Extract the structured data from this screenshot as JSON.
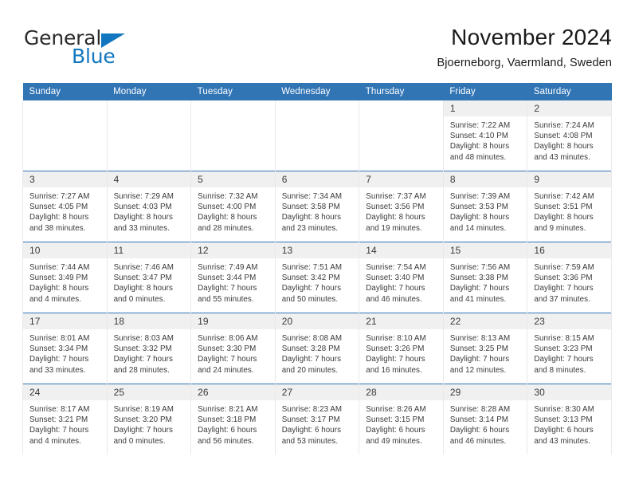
{
  "brand": {
    "name_top": "General",
    "name_bottom": "Blue",
    "triangle_icon": "triangle-icon",
    "accent_color": "#1277bf"
  },
  "header": {
    "title": "November 2024",
    "location": "Bjoerneborg, Vaermland, Sweden"
  },
  "theme": {
    "header_blue": "#3275b5",
    "daynum_band": "#f0f0f0",
    "text": "#3a3a3a"
  },
  "calendar": {
    "weekday_headers": [
      "Sunday",
      "Monday",
      "Tuesday",
      "Wednesday",
      "Thursday",
      "Friday",
      "Saturday"
    ],
    "weeks": [
      [
        {
          "day": "",
          "info": "",
          "empty": true
        },
        {
          "day": "",
          "info": "",
          "empty": true
        },
        {
          "day": "",
          "info": "",
          "empty": true
        },
        {
          "day": "",
          "info": "",
          "empty": true
        },
        {
          "day": "",
          "info": "",
          "empty": true
        },
        {
          "day": "1",
          "info": "Sunrise: 7:22 AM\nSunset: 4:10 PM\nDaylight: 8 hours\nand 48 minutes.",
          "empty": false
        },
        {
          "day": "2",
          "info": "Sunrise: 7:24 AM\nSunset: 4:08 PM\nDaylight: 8 hours\nand 43 minutes.",
          "empty": false
        }
      ],
      [
        {
          "day": "3",
          "info": "Sunrise: 7:27 AM\nSunset: 4:05 PM\nDaylight: 8 hours\nand 38 minutes.",
          "empty": false
        },
        {
          "day": "4",
          "info": "Sunrise: 7:29 AM\nSunset: 4:03 PM\nDaylight: 8 hours\nand 33 minutes.",
          "empty": false
        },
        {
          "day": "5",
          "info": "Sunrise: 7:32 AM\nSunset: 4:00 PM\nDaylight: 8 hours\nand 28 minutes.",
          "empty": false
        },
        {
          "day": "6",
          "info": "Sunrise: 7:34 AM\nSunset: 3:58 PM\nDaylight: 8 hours\nand 23 minutes.",
          "empty": false
        },
        {
          "day": "7",
          "info": "Sunrise: 7:37 AM\nSunset: 3:56 PM\nDaylight: 8 hours\nand 19 minutes.",
          "empty": false
        },
        {
          "day": "8",
          "info": "Sunrise: 7:39 AM\nSunset: 3:53 PM\nDaylight: 8 hours\nand 14 minutes.",
          "empty": false
        },
        {
          "day": "9",
          "info": "Sunrise: 7:42 AM\nSunset: 3:51 PM\nDaylight: 8 hours\nand 9 minutes.",
          "empty": false
        }
      ],
      [
        {
          "day": "10",
          "info": "Sunrise: 7:44 AM\nSunset: 3:49 PM\nDaylight: 8 hours\nand 4 minutes.",
          "empty": false
        },
        {
          "day": "11",
          "info": "Sunrise: 7:46 AM\nSunset: 3:47 PM\nDaylight: 8 hours\nand 0 minutes.",
          "empty": false
        },
        {
          "day": "12",
          "info": "Sunrise: 7:49 AM\nSunset: 3:44 PM\nDaylight: 7 hours\nand 55 minutes.",
          "empty": false
        },
        {
          "day": "13",
          "info": "Sunrise: 7:51 AM\nSunset: 3:42 PM\nDaylight: 7 hours\nand 50 minutes.",
          "empty": false
        },
        {
          "day": "14",
          "info": "Sunrise: 7:54 AM\nSunset: 3:40 PM\nDaylight: 7 hours\nand 46 minutes.",
          "empty": false
        },
        {
          "day": "15",
          "info": "Sunrise: 7:56 AM\nSunset: 3:38 PM\nDaylight: 7 hours\nand 41 minutes.",
          "empty": false
        },
        {
          "day": "16",
          "info": "Sunrise: 7:59 AM\nSunset: 3:36 PM\nDaylight: 7 hours\nand 37 minutes.",
          "empty": false
        }
      ],
      [
        {
          "day": "17",
          "info": "Sunrise: 8:01 AM\nSunset: 3:34 PM\nDaylight: 7 hours\nand 33 minutes.",
          "empty": false
        },
        {
          "day": "18",
          "info": "Sunrise: 8:03 AM\nSunset: 3:32 PM\nDaylight: 7 hours\nand 28 minutes.",
          "empty": false
        },
        {
          "day": "19",
          "info": "Sunrise: 8:06 AM\nSunset: 3:30 PM\nDaylight: 7 hours\nand 24 minutes.",
          "empty": false
        },
        {
          "day": "20",
          "info": "Sunrise: 8:08 AM\nSunset: 3:28 PM\nDaylight: 7 hours\nand 20 minutes.",
          "empty": false
        },
        {
          "day": "21",
          "info": "Sunrise: 8:10 AM\nSunset: 3:26 PM\nDaylight: 7 hours\nand 16 minutes.",
          "empty": false
        },
        {
          "day": "22",
          "info": "Sunrise: 8:13 AM\nSunset: 3:25 PM\nDaylight: 7 hours\nand 12 minutes.",
          "empty": false
        },
        {
          "day": "23",
          "info": "Sunrise: 8:15 AM\nSunset: 3:23 PM\nDaylight: 7 hours\nand 8 minutes.",
          "empty": false
        }
      ],
      [
        {
          "day": "24",
          "info": "Sunrise: 8:17 AM\nSunset: 3:21 PM\nDaylight: 7 hours\nand 4 minutes.",
          "empty": false
        },
        {
          "day": "25",
          "info": "Sunrise: 8:19 AM\nSunset: 3:20 PM\nDaylight: 7 hours\nand 0 minutes.",
          "empty": false
        },
        {
          "day": "26",
          "info": "Sunrise: 8:21 AM\nSunset: 3:18 PM\nDaylight: 6 hours\nand 56 minutes.",
          "empty": false
        },
        {
          "day": "27",
          "info": "Sunrise: 8:23 AM\nSunset: 3:17 PM\nDaylight: 6 hours\nand 53 minutes.",
          "empty": false
        },
        {
          "day": "28",
          "info": "Sunrise: 8:26 AM\nSunset: 3:15 PM\nDaylight: 6 hours\nand 49 minutes.",
          "empty": false
        },
        {
          "day": "29",
          "info": "Sunrise: 8:28 AM\nSunset: 3:14 PM\nDaylight: 6 hours\nand 46 minutes.",
          "empty": false
        },
        {
          "day": "30",
          "info": "Sunrise: 8:30 AM\nSunset: 3:13 PM\nDaylight: 6 hours\nand 43 minutes.",
          "empty": false
        }
      ]
    ]
  }
}
